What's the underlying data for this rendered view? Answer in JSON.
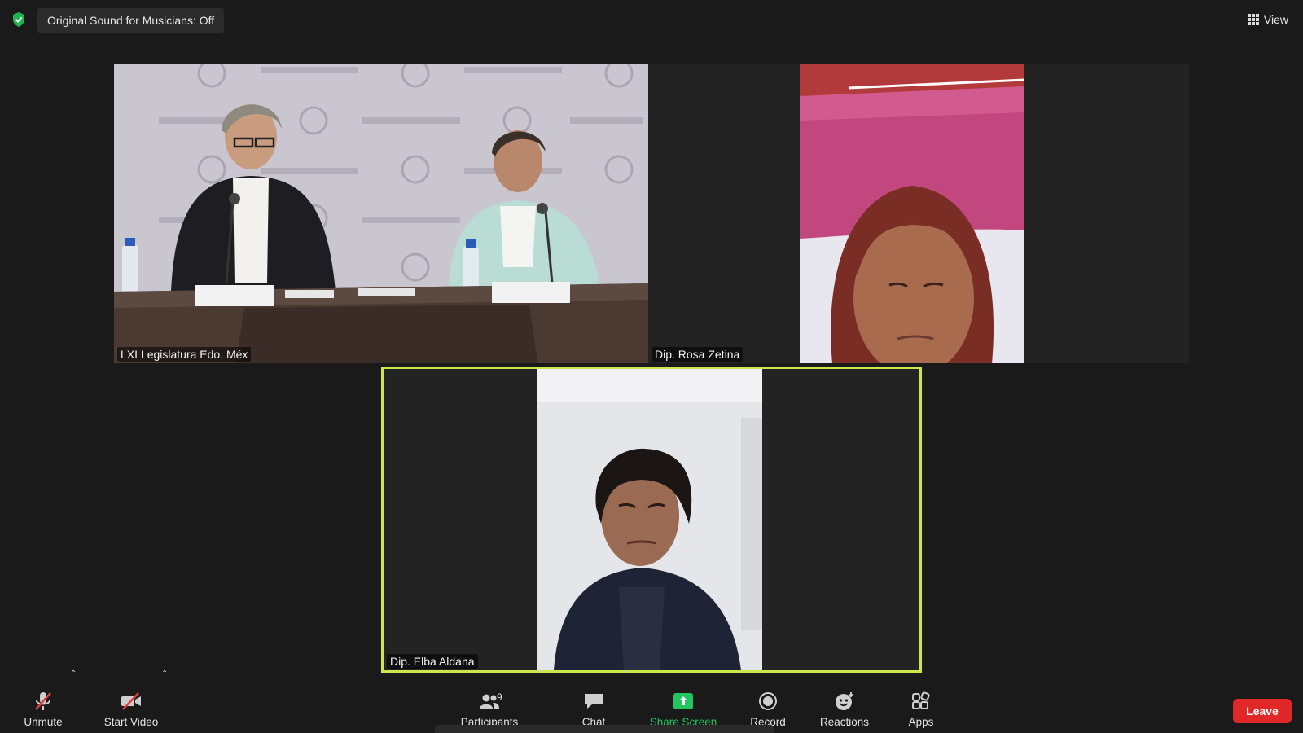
{
  "topbar": {
    "sound_label": "Original Sound for Musicians: Off",
    "view_label": "View",
    "shield_color": "#1fb451"
  },
  "participants_tiles": [
    {
      "name": "LXI Legislatura Edo. Méx"
    },
    {
      "name": "Dip. Rosa Zetina"
    },
    {
      "name": "Dip. Elba Aldana"
    }
  ],
  "active_speaker_color": "#c9e84a",
  "toolbar": {
    "unmute": "Unmute",
    "start_video": "Start Video",
    "participants": "Participants",
    "participant_count": "9",
    "chat": "Chat",
    "share_screen": "Share Screen",
    "share_color": "#22c55e",
    "record": "Record",
    "reactions": "Reactions",
    "apps": "Apps",
    "leave": "Leave",
    "leave_color": "#e02828"
  }
}
